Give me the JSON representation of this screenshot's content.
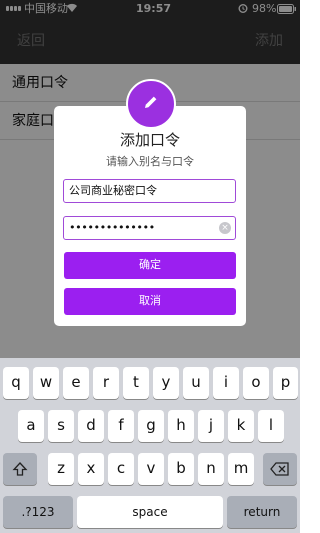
{
  "status_bar": {
    "carrier": "中国移动",
    "time": "19:57",
    "battery": "98%"
  },
  "nav": {
    "back": "返回",
    "add": "添加"
  },
  "list": {
    "items": [
      {
        "label": "通用口令"
      },
      {
        "label": "家庭口"
      }
    ]
  },
  "dialog": {
    "title": "添加口令",
    "subtitle": "请输入别名与口令",
    "alias_value": "公司商业秘密口令",
    "password_value": "••••••••••••••",
    "clear_glyph": "×",
    "confirm_label": "确定",
    "cancel_label": "取消",
    "accent_color": "#9b1ff0"
  },
  "keyboard": {
    "row1": [
      "q",
      "w",
      "e",
      "r",
      "t",
      "y",
      "u",
      "i",
      "o",
      "p"
    ],
    "row2": [
      "a",
      "s",
      "d",
      "f",
      "g",
      "h",
      "j",
      "k",
      "l"
    ],
    "row3": [
      "z",
      "x",
      "c",
      "v",
      "b",
      "n",
      "m"
    ],
    "shift_icon": "shift-icon",
    "backspace_icon": "backspace-icon",
    "numbers_label": ".?123",
    "space_label": "space",
    "return_label": "return"
  }
}
